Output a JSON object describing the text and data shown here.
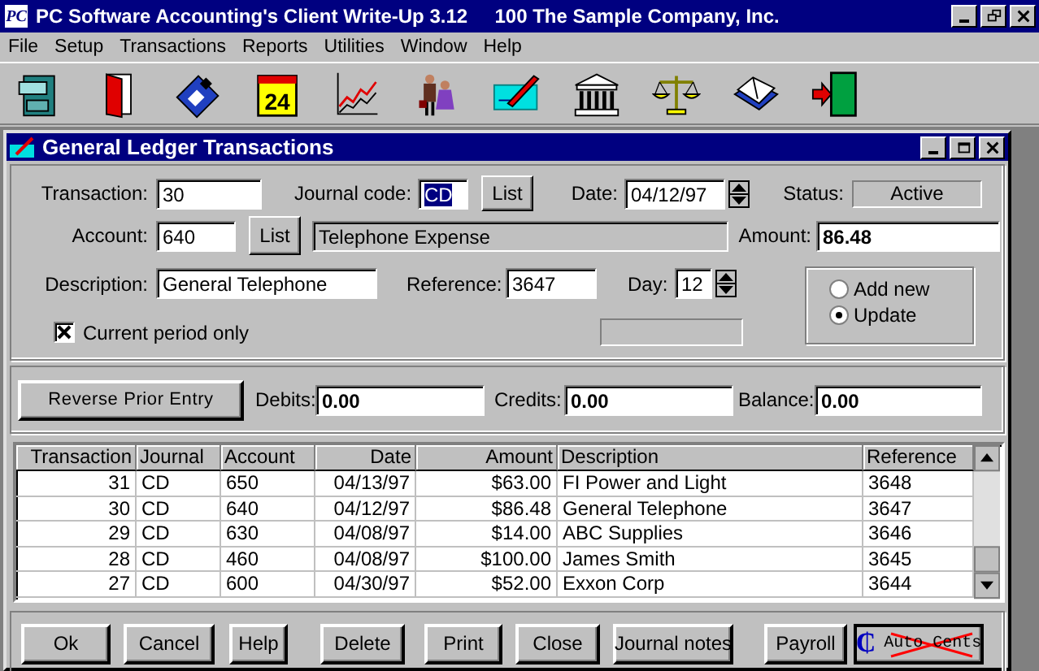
{
  "app_window": {
    "logo_text": "PC",
    "title": "PC Software Accounting's Client Write-Up 3.12     100 The Sample Company, Inc."
  },
  "menu": [
    {
      "label": "File"
    },
    {
      "label": "Setup"
    },
    {
      "label": "Transactions"
    },
    {
      "label": "Reports"
    },
    {
      "label": "Utilities"
    },
    {
      "label": "Window"
    },
    {
      "label": "Help"
    }
  ],
  "toolbar": [
    {
      "kind": "cabinet"
    },
    {
      "kind": "door"
    },
    {
      "kind": "disk"
    },
    {
      "kind": "calendar",
      "text": "24"
    },
    {
      "kind": "chart"
    },
    {
      "kind": "people"
    },
    {
      "kind": "check"
    },
    {
      "kind": "bank"
    },
    {
      "kind": "scale"
    },
    {
      "kind": "book"
    },
    {
      "kind": "exit"
    }
  ],
  "child_window": {
    "title": "General Ledger Transactions",
    "form": {
      "transaction": {
        "label": "Transaction:",
        "value": "30"
      },
      "journal_code": {
        "label": "Journal code:",
        "value": "CD",
        "selected": true
      },
      "journal_list_button": {
        "label": "List"
      },
      "date": {
        "label": "Date:",
        "value": "04/12/97"
      },
      "status": {
        "label": "Status:",
        "value": "Active"
      },
      "account": {
        "label": "Account:",
        "value": "640"
      },
      "account_list_button": {
        "label": "List"
      },
      "account_name": "Telephone Expense",
      "amount": {
        "label": "Amount:",
        "value": "86.48"
      },
      "description": {
        "label": "Description:",
        "value": "General Telephone"
      },
      "reference": {
        "label": "Reference:",
        "value": "3647"
      },
      "day": {
        "label": "Day:",
        "value": "12"
      },
      "mode": [
        {
          "label": "Add new",
          "selected": false
        },
        {
          "label": "Update",
          "selected": true
        }
      ],
      "current_period_only": {
        "label": "Current period only",
        "checked": true
      }
    },
    "totals": {
      "reverse_button": {
        "label": "Reverse Prior Entry"
      },
      "debits": {
        "label": "Debits:",
        "value": "0.00"
      },
      "credits": {
        "label": "Credits:",
        "value": "0.00"
      },
      "balance": {
        "label": "Balance:",
        "value": "0.00"
      }
    },
    "table": {
      "columns": [
        "Transaction",
        "Journal",
        "Account",
        "Date",
        "Amount",
        "Description",
        "Reference"
      ],
      "rows": [
        [
          "31",
          "CD",
          "650",
          "04/13/97",
          "$63.00",
          "FI Power and Light",
          "3648"
        ],
        [
          "30",
          "CD",
          "640",
          "04/12/97",
          "$86.48",
          "General Telephone",
          "3647"
        ],
        [
          "29",
          "CD",
          "630",
          "04/08/97",
          "$14.00",
          "ABC Supplies",
          "3646"
        ],
        [
          "28",
          "CD",
          "460",
          "04/08/97",
          "$100.00",
          "James Smith",
          "3645"
        ],
        [
          "27",
          "CD",
          "600",
          "04/30/97",
          "$52.00",
          "Exxon Corp",
          "3644"
        ]
      ]
    },
    "buttons": [
      {
        "label": "Ok",
        "kind": "plain"
      },
      {
        "label": "Cancel",
        "kind": "plain"
      },
      {
        "label": "Help",
        "kind": "plain"
      },
      {
        "label": "Delete",
        "kind": "plain"
      },
      {
        "label": "Print",
        "kind": "plain"
      },
      {
        "label": "Close",
        "kind": "plain"
      },
      {
        "label": "Journal notes",
        "kind": "plain"
      },
      {
        "label": "Payroll",
        "kind": "plain"
      },
      {
        "label": "Auto Cents",
        "symbol": "₵",
        "kind": "crossed"
      }
    ]
  }
}
